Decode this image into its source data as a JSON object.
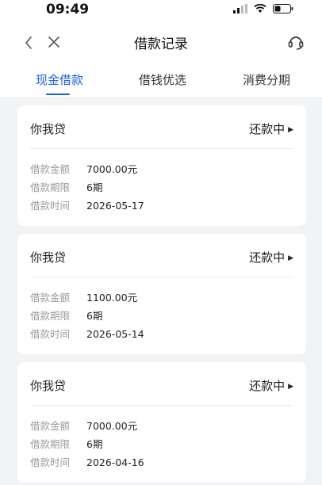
{
  "status_bar": {
    "time": "09:49"
  },
  "nav": {
    "title": "借款记录"
  },
  "tabs": [
    "现金借款",
    "借钱优选",
    "消费分期"
  ],
  "records": [
    {
      "product": "你我贷",
      "status": "还款中",
      "amount_label": "借款金额",
      "amount": "7000.00元",
      "term_label": "借款期限",
      "term": "6期",
      "date_label": "借款时间",
      "date": "2026-05-17"
    },
    {
      "product": "你我贷",
      "status": "还款中",
      "amount_label": "借款金额",
      "amount": "1100.00元",
      "term_label": "借款期限",
      "term": "6期",
      "date_label": "借款时间",
      "date": "2026-05-14"
    },
    {
      "product": "你我贷",
      "status": "还款中",
      "amount_label": "借款金额",
      "amount": "7000.00元",
      "term_label": "借款期限",
      "term": "6期",
      "date_label": "借款时间",
      "date": "2026-04-16"
    }
  ],
  "colors": {
    "accent": "#1d5fd8",
    "background": "#f2f3f5"
  },
  "icons": {
    "back": "chevron-left-icon",
    "close": "close-icon",
    "service": "headset-icon"
  }
}
